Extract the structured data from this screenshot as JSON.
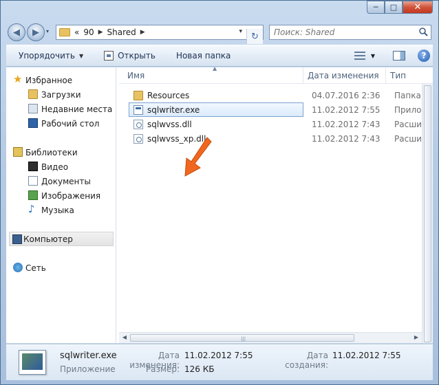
{
  "window": {
    "minimize_glyph": "─",
    "maximize_glyph": "□",
    "close_glyph": "✕"
  },
  "nav": {
    "back_glyph": "◀",
    "forward_glyph": "▶",
    "history_glyph": "▾",
    "breadcrumb_prefix": "«",
    "breadcrumb": [
      "90",
      "Shared"
    ],
    "crumb_sep": "▶",
    "address_dropdown": "▾",
    "refresh_glyph": "↻",
    "search_placeholder": "Поиск: Shared",
    "search_icon": "search-icon"
  },
  "toolbar": {
    "organize_label": "Упорядочить",
    "organize_arrow": "▼",
    "open_label": "Открыть",
    "new_folder_label": "Новая папка",
    "view_arrow": "▼",
    "help_glyph": "?"
  },
  "sidebar": {
    "favorites": {
      "label": "Избранное",
      "items": [
        "Загрузки",
        "Недавние места",
        "Рабочий стол"
      ]
    },
    "libraries": {
      "label": "Библиотеки",
      "items": [
        "Видео",
        "Документы",
        "Изображения",
        "Музыка"
      ]
    },
    "computer": "Компьютер",
    "network": "Сеть",
    "star_glyph": "★",
    "music_glyph": "♪"
  },
  "columns": {
    "name": "Имя",
    "date": "Дата изменения",
    "type": "Тип",
    "sort_glyph": "▲"
  },
  "files": [
    {
      "name": "Resources",
      "date": "04.07.2016 2:36",
      "type": "Папка с файлами",
      "icon": "folder-icon"
    },
    {
      "name": "sqlwriter.exe",
      "date": "11.02.2012 7:55",
      "type": "Приложение",
      "icon": "exe-icon",
      "selected": true
    },
    {
      "name": "sqlwvss.dll",
      "date": "11.02.2012 7:43",
      "type": "Расширение приложения",
      "icon": "dll-icon"
    },
    {
      "name": "sqlwvss_xp.dll",
      "date": "11.02.2012 7:43",
      "type": "Расширение приложения",
      "icon": "dll-icon"
    }
  ],
  "hscroll": {
    "left_glyph": "◀",
    "right_glyph": "▶",
    "grip": "|||"
  },
  "details": {
    "file_name": "sqlwriter.exe",
    "file_type": "Приложение",
    "modified_label": "Дата изменения:",
    "modified_value": "11.02.2012 7:55",
    "size_label": "Размер:",
    "size_value": "126 КБ",
    "created_label": "Дата создания:",
    "created_value": "11.02.2012 7:55"
  },
  "colors": {
    "annotation_arrow": "#f0681f",
    "selection_border": "#7da2ce"
  }
}
